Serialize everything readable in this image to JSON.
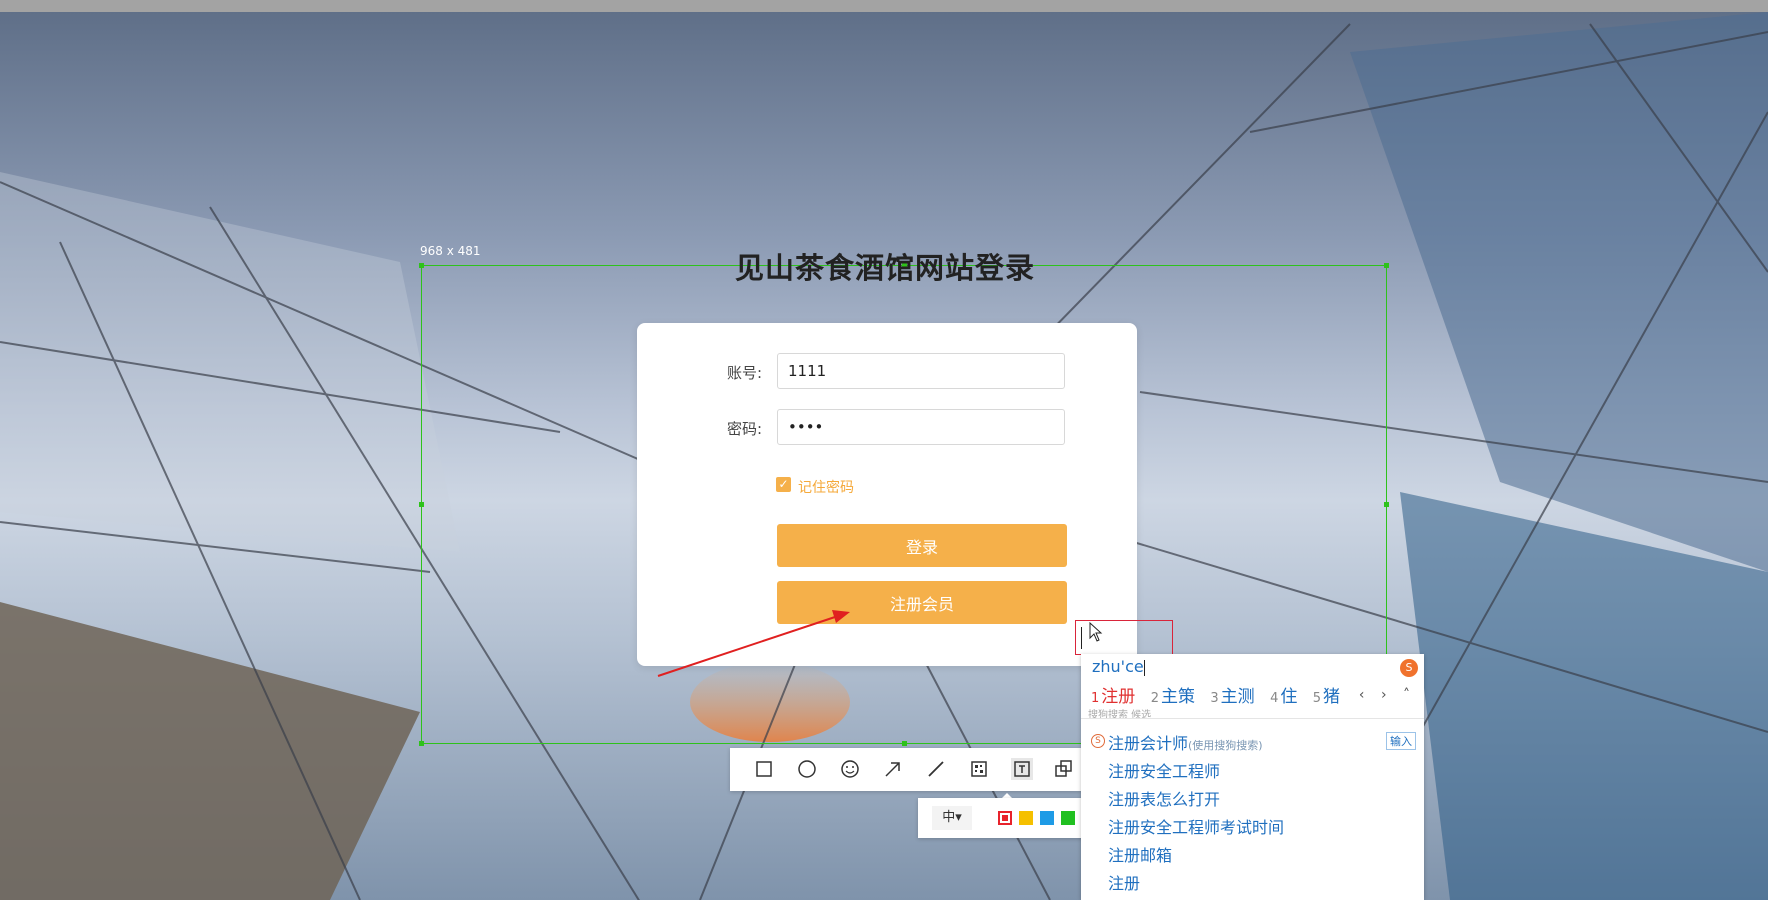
{
  "screenshot": {
    "selection_size_label": "968 x 481"
  },
  "page": {
    "title": "见山茶食酒馆网站登录"
  },
  "login_form": {
    "account_label": "账号:",
    "account_value": "1111",
    "password_label": "密码:",
    "password_value": "••••",
    "remember_label": "记住密码",
    "remember_checked": true,
    "login_button": "登录",
    "register_button": "注册会员"
  },
  "annotation_toolbar": {
    "tools": [
      "rectangle-icon",
      "ellipse-icon",
      "emoji-icon",
      "arrow-icon",
      "line-icon",
      "mosaic-icon",
      "text-icon",
      "copy-icon"
    ],
    "active_tool": "text-icon",
    "font_size_option": "中▾",
    "colors": [
      "#e8232c",
      "#f5c000",
      "#1e9be6",
      "#20c020"
    ]
  },
  "ime": {
    "pinyin": "zhu'ce",
    "candidates": [
      {
        "num": "1",
        "text": "注册"
      },
      {
        "num": "2",
        "text": "主策"
      },
      {
        "num": "3",
        "text": "主测"
      },
      {
        "num": "4",
        "text": "住"
      },
      {
        "num": "5",
        "text": "猪"
      }
    ],
    "nav": "‹ › ˄",
    "hint": "搜狗搜索 候选",
    "suggestions": [
      {
        "text": "注册会计师",
        "note": "(使用搜狗搜索)"
      },
      {
        "text": "注册安全工程师"
      },
      {
        "text": "注册表怎么打开"
      },
      {
        "text": "注册安全工程师考试时间"
      },
      {
        "text": "注册邮箱"
      },
      {
        "text": "注册"
      }
    ],
    "enter_label": "输入"
  }
}
